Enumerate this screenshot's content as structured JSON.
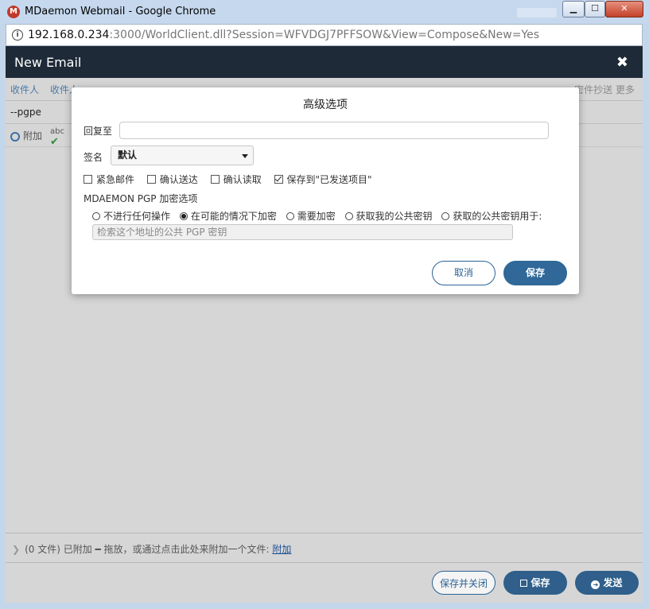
{
  "window": {
    "title": "MDaemon Webmail - Google Chrome",
    "url_host": "192.168.0.234",
    "url_rest": ":3000/WorldClient.dll?Session=WFVDGJ7PFFSOW&View=Compose&New=Yes"
  },
  "app": {
    "title": "New Email",
    "close_symbol": "✖"
  },
  "compose": {
    "recipients_label": "收件人",
    "recipients_label_cut": "收件人",
    "right_links": "密件抄送  更多",
    "subject": "--pgpe",
    "attach_label": "附加",
    "spell_label": "abc"
  },
  "attachments": {
    "text": "(0 文件) 已附加 ━ 拖放，或通过点击此处来附加一个文件: ",
    "link": "附加"
  },
  "buttons": {
    "save_close": "保存并关闭",
    "save": "保存",
    "send": "发送"
  },
  "dialog": {
    "title": "高级选项",
    "reply_to_label": "回复至",
    "reply_to_value": "",
    "signature_label": "签名",
    "signature_value": "默认",
    "checkboxes": [
      {
        "label": "紧急邮件",
        "checked": false
      },
      {
        "label": "确认送达",
        "checked": false
      },
      {
        "label": "确认读取",
        "checked": false
      },
      {
        "label": "保存到\"已发送项目\"",
        "checked": true
      }
    ],
    "pgp_title": "MDAEMON PGP 加密选项",
    "pgp_options": [
      {
        "label": "不进行任何操作",
        "checked": false
      },
      {
        "label": "在可能的情况下加密",
        "checked": true
      },
      {
        "label": "需要加密",
        "checked": false
      },
      {
        "label": "获取我的公共密钥",
        "checked": false
      },
      {
        "label": "获取的公共密钥用于:",
        "checked": false
      }
    ],
    "lookup_placeholder": "检索这个地址的公共 PGP 密钥",
    "cancel": "取消",
    "save": "保存"
  }
}
